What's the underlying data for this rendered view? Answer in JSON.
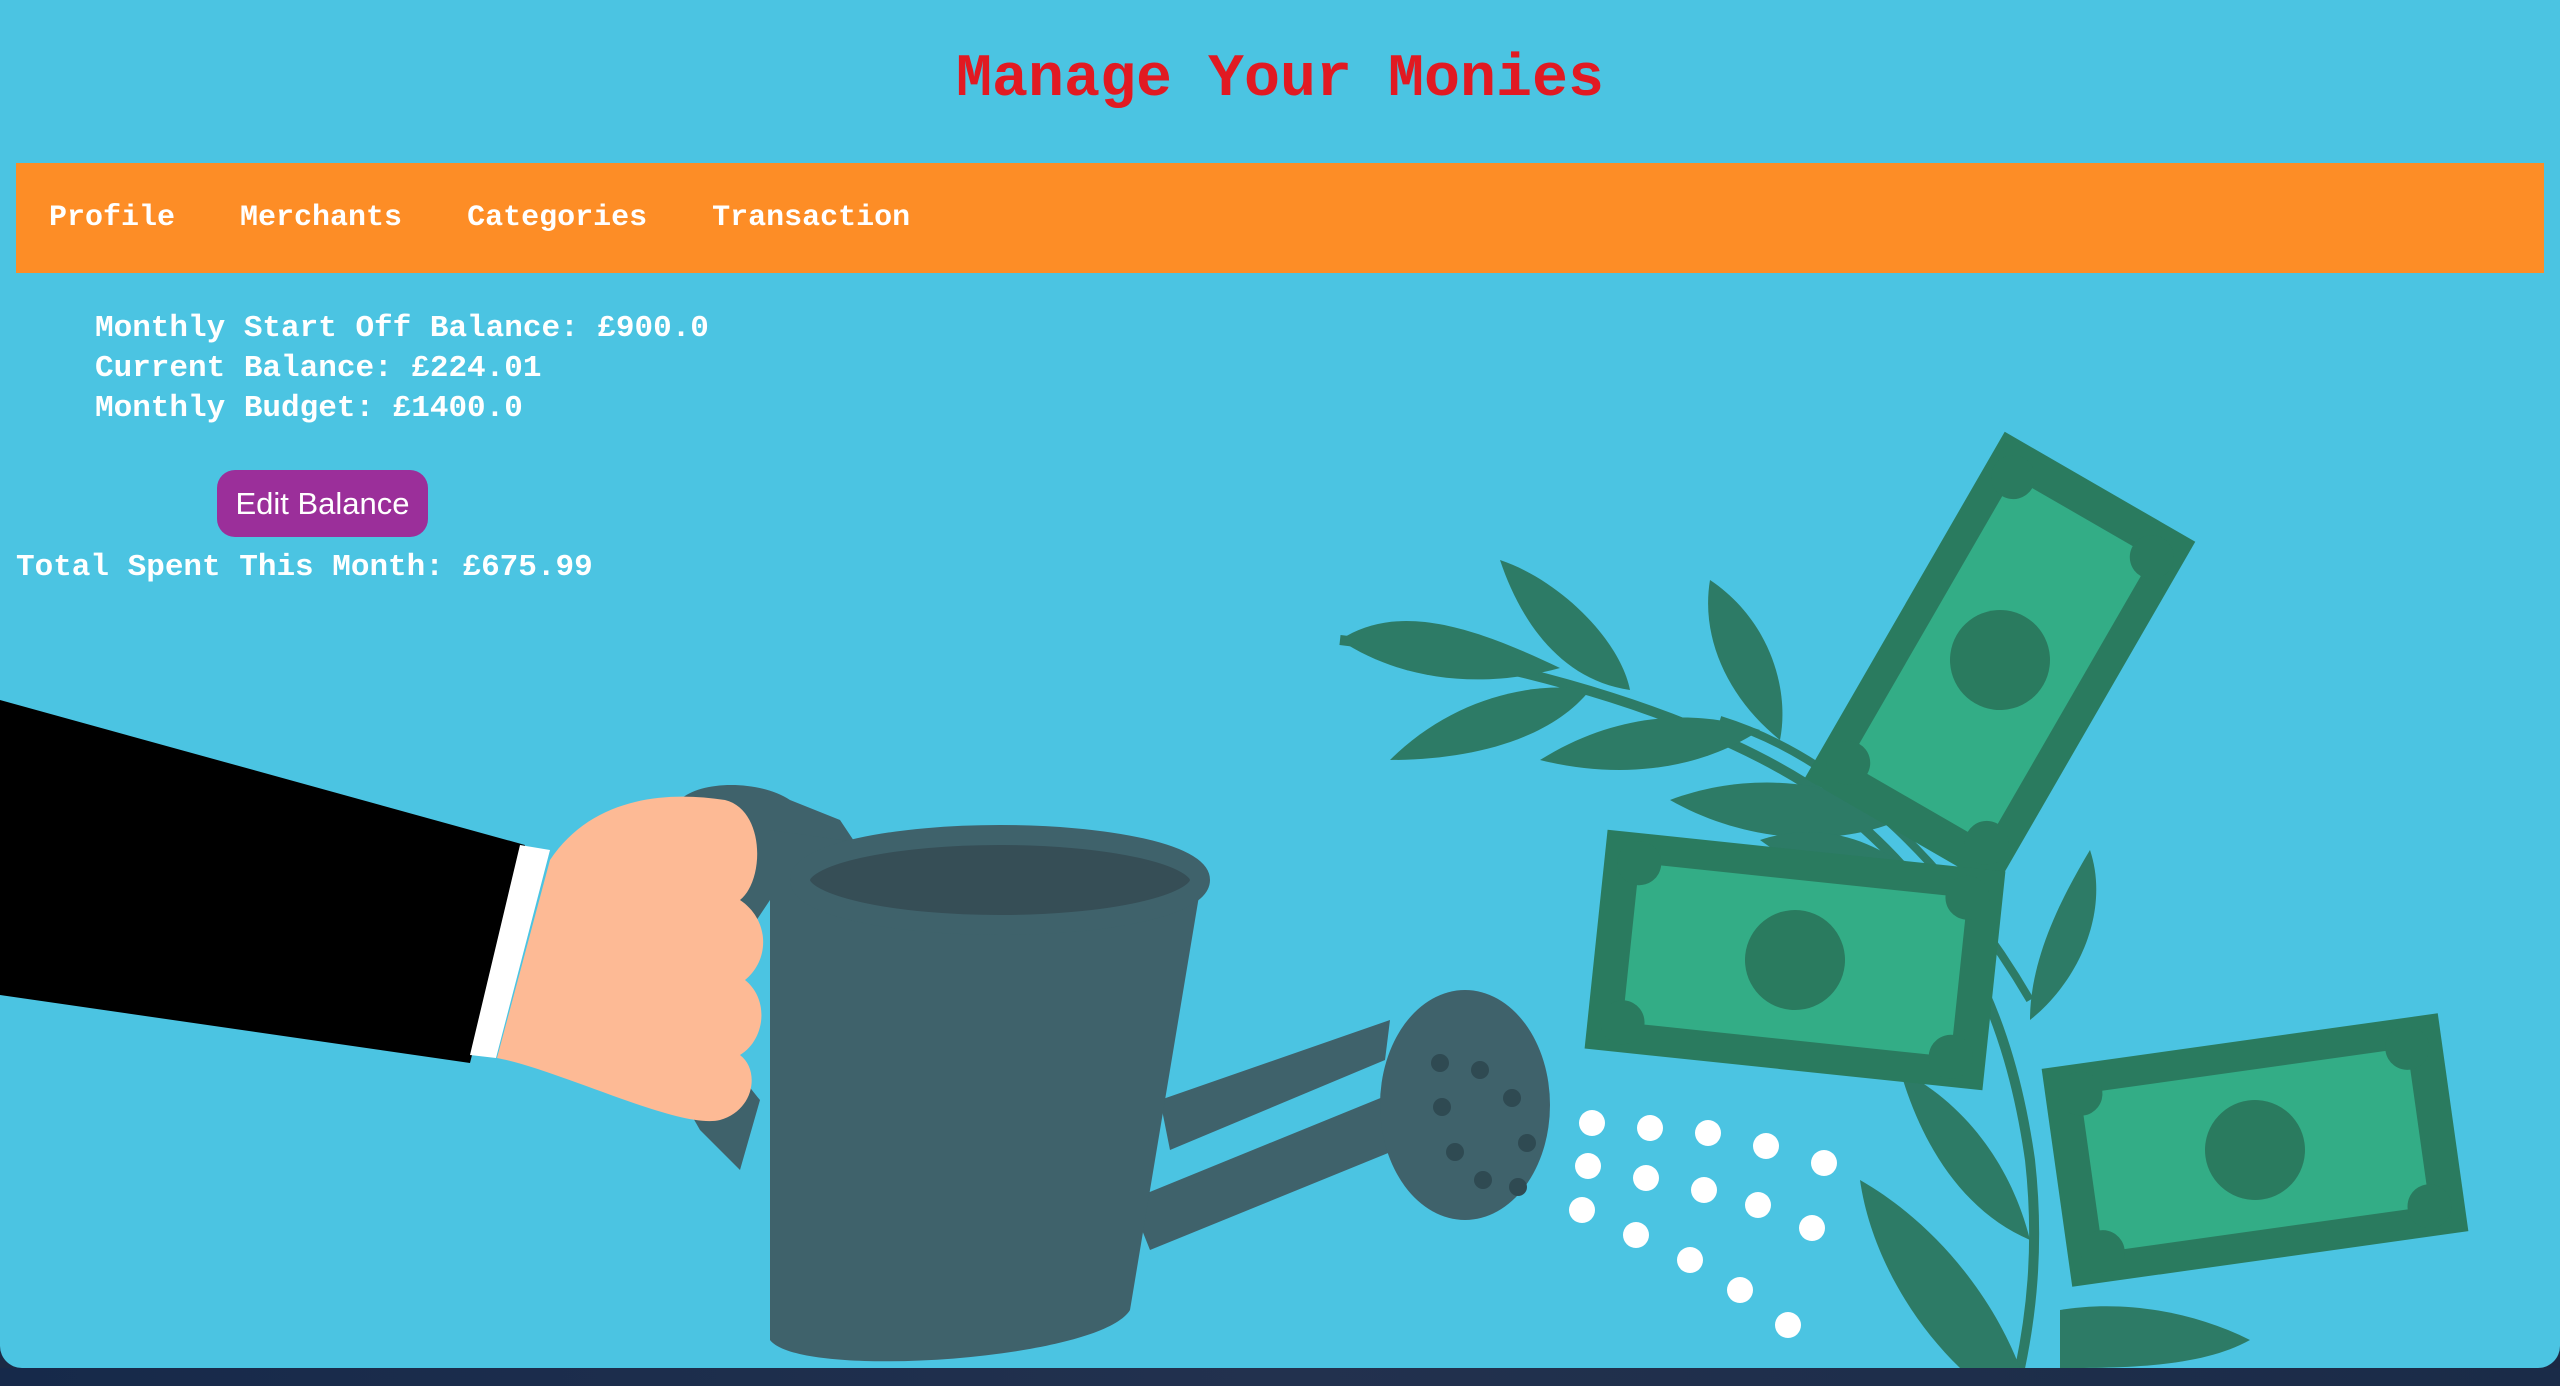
{
  "header": {
    "title": "Manage Your Monies"
  },
  "nav": {
    "items": [
      {
        "label": "Profile"
      },
      {
        "label": "Merchants"
      },
      {
        "label": "Categories"
      },
      {
        "label": "Transaction"
      }
    ]
  },
  "balances": {
    "start_off": "Monthly Start Off Balance: £900.0",
    "current": "Current Balance: £224.01",
    "budget": "Monthly Budget: £1400.0",
    "edit_button_label": "Edit Balance",
    "total_spent": "Total Spent This Month: £675.99"
  },
  "illustration": {
    "icons": [
      "arm-icon",
      "watering-can-icon",
      "water-drops-icon",
      "money-plant-icon",
      "banknote-icon"
    ]
  },
  "colors": {
    "background": "#4bc4e2",
    "title": "#e11a22",
    "nav": "#fd8d26",
    "button": "#9b2f9a",
    "banknote_dark": "#2a7b5f",
    "banknote_light": "#33ad86",
    "leaf": "#2d7b66",
    "watering_can": "#3f626b"
  }
}
